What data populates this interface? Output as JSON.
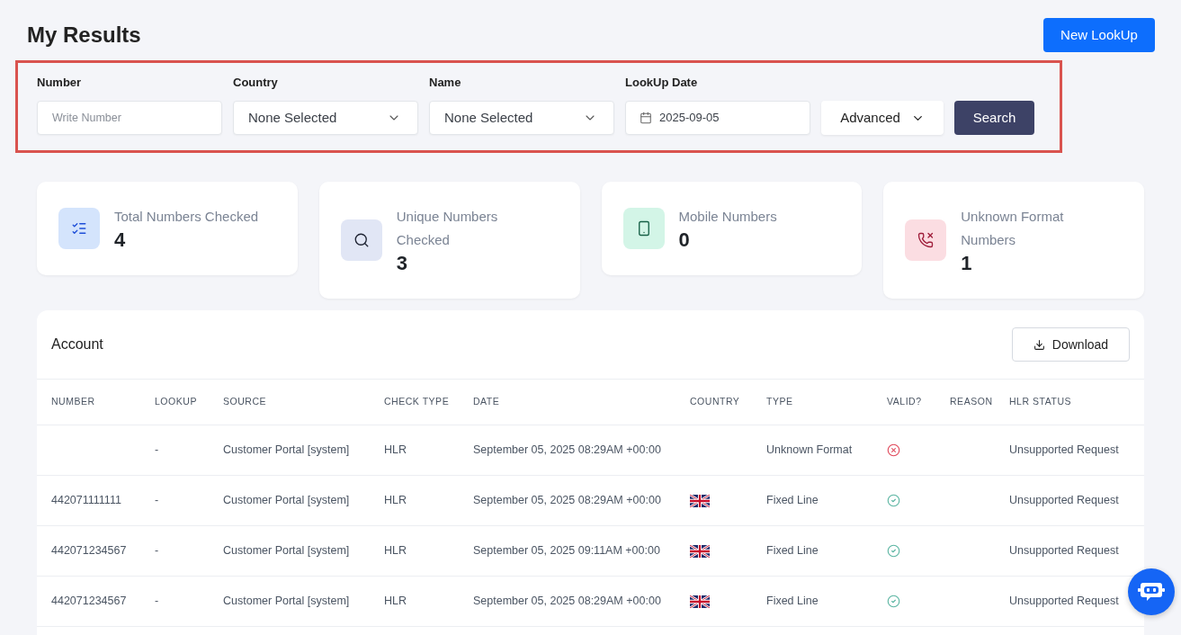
{
  "page": {
    "title": "My Results",
    "new_lookup_button": "New LookUp"
  },
  "filters": {
    "fields": [
      {
        "kind": "text",
        "label": "Number",
        "placeholder": "Write Number"
      },
      {
        "kind": "select",
        "label": "Country",
        "value": "None Selected"
      },
      {
        "kind": "select",
        "label": "Name",
        "value": "None Selected"
      },
      {
        "kind": "date",
        "label": "LookUp Date",
        "value": "2025-09-05"
      }
    ],
    "advanced_button": "Advanced",
    "search_button": "Search"
  },
  "stats": [
    {
      "label": "Total Numbers Checked",
      "value": "4"
    },
    {
      "label": "Unique Numbers Checked",
      "value": "3"
    },
    {
      "label": "Mobile Numbers",
      "value": "0"
    },
    {
      "label": "Unknown Format Numbers",
      "value": "1"
    }
  ],
  "table": {
    "title": "Account",
    "download_button": "Download",
    "columns": [
      "NUMBER",
      "LOOKUP",
      "SOURCE",
      "CHECK TYPE",
      "DATE",
      "COUNTRY",
      "TYPE",
      "VALID?",
      "REASON",
      "HLR STATUS"
    ],
    "rows": [
      {
        "lookup": "-",
        "source": "Customer Portal [system]",
        "check_type": "HLR",
        "date": "September 05, 2025 08:29AM +00:00",
        "flag": false,
        "type": "Unknown Format",
        "valid": false,
        "hlr_status": "Unsupported Request"
      },
      {
        "number": "442071111111",
        "lookup": "-",
        "source": "Customer Portal [system]",
        "check_type": "HLR",
        "date": "September 05, 2025 08:29AM +00:00",
        "flag": true,
        "type": "Fixed Line",
        "valid": true,
        "hlr_status": "Unsupported Request"
      },
      {
        "number": "442071234567",
        "lookup": "-",
        "source": "Customer Portal [system]",
        "check_type": "HLR",
        "date": "September 05, 2025 09:11AM +00:00",
        "flag": true,
        "type": "Fixed Line",
        "valid": true,
        "hlr_status": "Unsupported Request"
      },
      {
        "number": "442071234567",
        "lookup": "-",
        "source": "Customer Portal [system]",
        "check_type": "HLR",
        "date": "September 05, 2025 08:29AM +00:00",
        "flag": true,
        "type": "Fixed Line",
        "valid": true,
        "hlr_status": "Unsupported Request"
      }
    ]
  }
}
